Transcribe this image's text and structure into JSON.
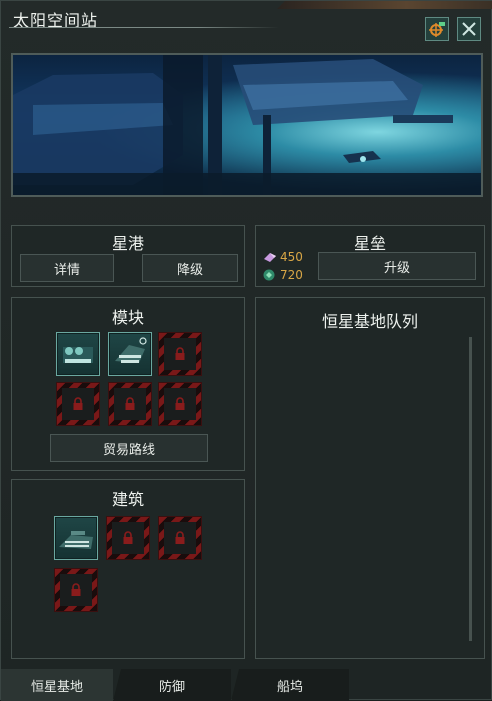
{
  "window": {
    "title": "太阳空间站"
  },
  "header_buttons": [
    {
      "icon": "camera-target-icon"
    },
    {
      "icon": "close-icon"
    }
  ],
  "starport": {
    "title": "星港",
    "details_label": "详情",
    "downgrade_label": "降级"
  },
  "citadel": {
    "title": "星垒",
    "alloys": "450",
    "influence": "720",
    "upgrade_label": "升级"
  },
  "modules": {
    "title": "模块",
    "slots": [
      "built",
      "built",
      "locked",
      "locked",
      "locked",
      "locked"
    ],
    "trade_route_label": "贸易路线"
  },
  "buildings": {
    "title": "建筑",
    "slots": [
      "built",
      "locked",
      "locked",
      "locked"
    ]
  },
  "queue": {
    "title": "恒星基地队列"
  },
  "tabs": [
    {
      "label": "恒星基地",
      "active": true
    },
    {
      "label": "防御",
      "active": false
    },
    {
      "label": "船坞",
      "active": false
    }
  ],
  "colors": {
    "locked_stripe": "#7a1818",
    "resource_text": "#d8a646",
    "accent_teal": "#5f8a82"
  }
}
